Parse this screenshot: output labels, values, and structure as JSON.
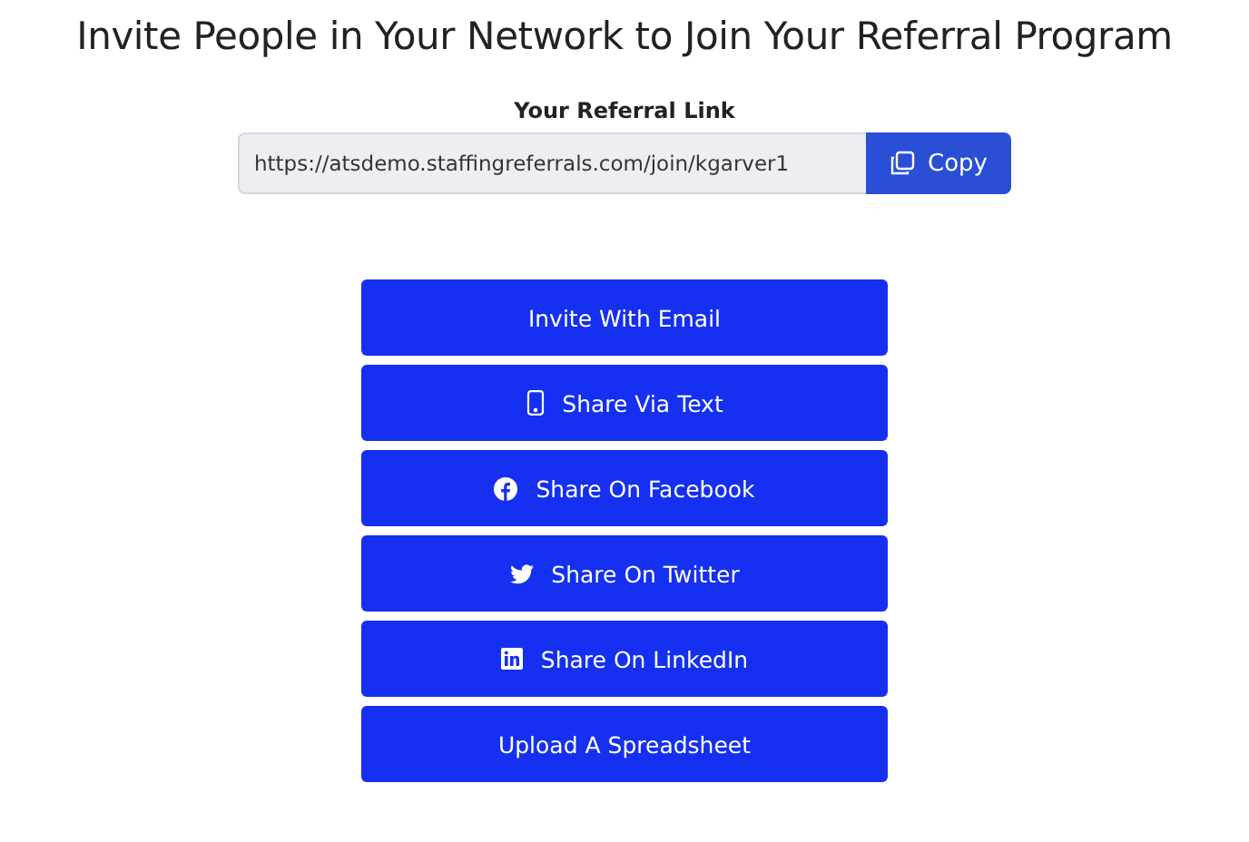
{
  "title": "Invite People in Your Network to Join Your Referral Program",
  "referral": {
    "label": "Your Referral Link",
    "value": "https://atsdemo.staffingreferrals.com/join/kgarver1",
    "copy_button": "Copy"
  },
  "actions": [
    {
      "label": "Invite With Email",
      "kind": "email"
    },
    {
      "label": "Share Via Text",
      "kind": "phone"
    },
    {
      "label": "Share On Facebook",
      "kind": "facebook"
    },
    {
      "label": "Share On Twitter",
      "kind": "twitter"
    },
    {
      "label": "Share On LinkedIn",
      "kind": "linkedin"
    },
    {
      "label": "Upload A Spreadsheet",
      "kind": "upload"
    }
  ]
}
